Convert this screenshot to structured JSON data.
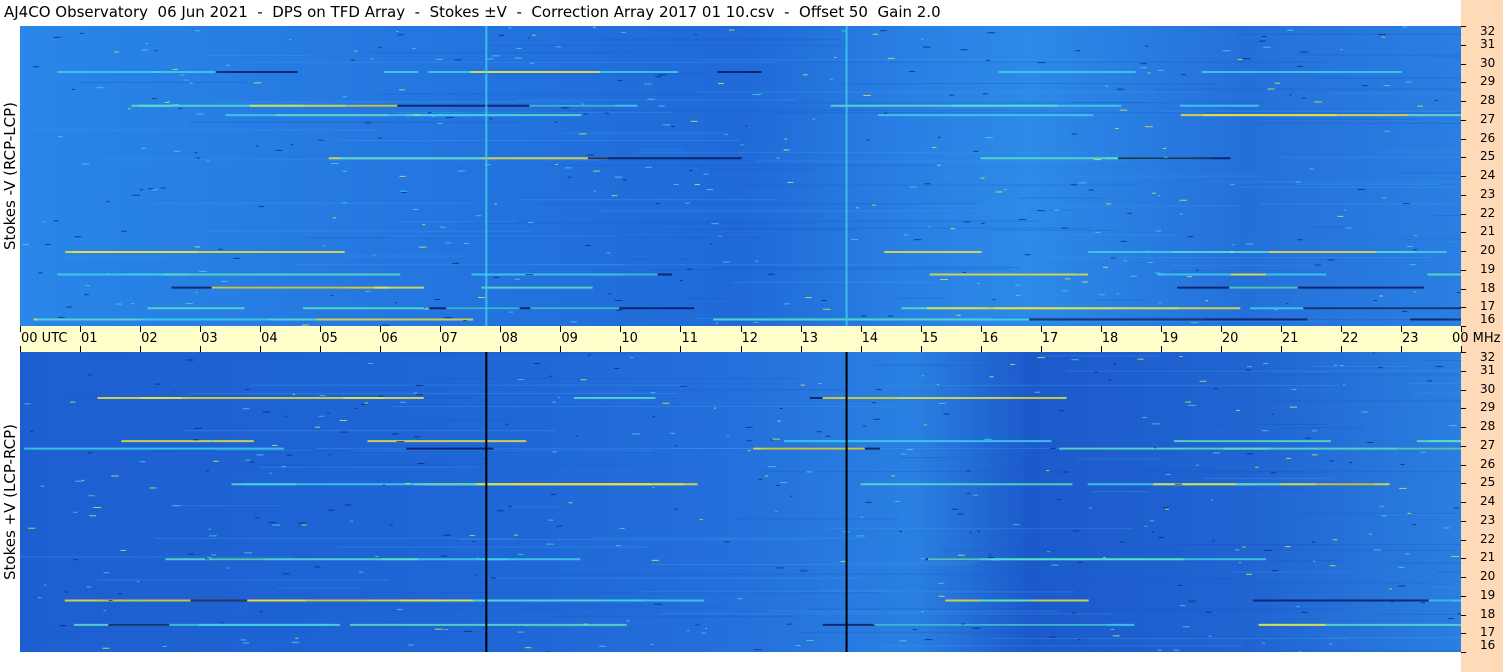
{
  "title": "AJ4CO Observatory  06 Jun 2021  -  DPS on TFD Array  -  Stokes ±V  -  Correction Array 2017 01 10.csv  -  Offset 50  Gain 2.0",
  "colors": {
    "background_blue": "#1e6fd9",
    "cyan": "#3fd0e8",
    "yellow": "#e8e040",
    "dark": "#0a1a60",
    "timebar": "#ffffcc",
    "freq_strip": "#ffdab9"
  },
  "chart_data": [
    {
      "type": "heatmap",
      "ylabel": "Stokes -V (RCP-LCP)",
      "ylabel_right": "",
      "x_ticks": [
        "00 UTC",
        "01",
        "02",
        "03",
        "04",
        "05",
        "06",
        "07",
        "08",
        "09",
        "10",
        "11",
        "12",
        "13",
        "14",
        "15",
        "16",
        "17",
        "18",
        "19",
        "20",
        "21",
        "22",
        "23",
        "00 MHz"
      ],
      "y_ticks": [
        "32",
        "31",
        "30",
        "29",
        "28",
        "27",
        "26",
        "25",
        "24",
        "23",
        "22",
        "21",
        "20",
        "19",
        "18",
        "17",
        "16"
      ],
      "ylim": [
        16,
        32
      ],
      "xlim": [
        0,
        24
      ],
      "marker_times": [
        7.75,
        13.75
      ],
      "marker_color": "#3fd0e8",
      "bright_bands_mhz": [
        29.6,
        27.8,
        27.3,
        25.0,
        20.0,
        18.8,
        18.1,
        17.0,
        16.4
      ]
    },
    {
      "type": "heatmap",
      "ylabel": "Stokes +V (LCP-RCP)",
      "y_ticks": [
        "32",
        "31",
        "30",
        "29",
        "28",
        "27",
        "26",
        "25",
        "24",
        "23",
        "22",
        "21",
        "20",
        "19",
        "18",
        "17",
        "16"
      ],
      "ylim": [
        16,
        32
      ],
      "xlim": [
        0,
        24
      ],
      "marker_times": [
        7.75,
        13.75
      ],
      "marker_color": "#000000",
      "bright_bands_mhz": [
        29.6,
        27.3,
        26.9,
        25.0,
        21.0,
        18.8,
        17.5
      ]
    }
  ]
}
